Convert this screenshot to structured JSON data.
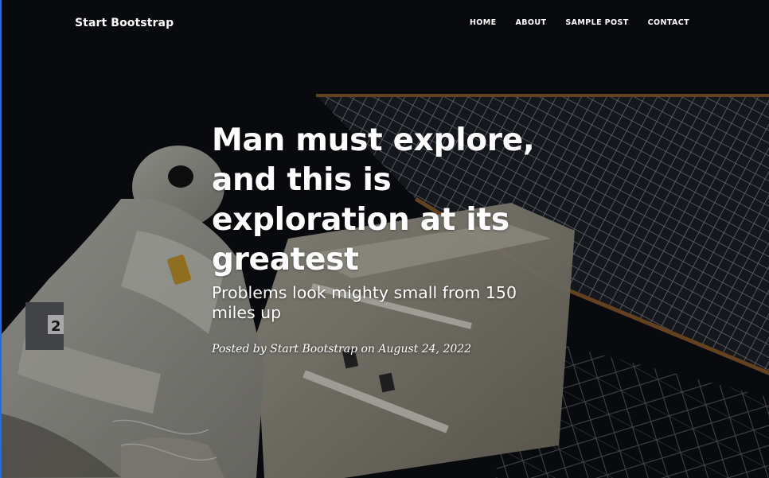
{
  "navbar": {
    "brand": "Start Bootstrap",
    "links": [
      "HOME",
      "ABOUT",
      "SAMPLE POST",
      "CONTACT"
    ]
  },
  "header": {
    "title": "Man must explore, and this is exploration at its greatest",
    "subtitle": "Problems look mighty small from 150 miles up",
    "meta": "Posted by Start Bootstrap on August 24, 2022"
  },
  "colors": {
    "background": "#0d0f13",
    "text": "#ffffff",
    "accent_edge": "#1e6fd9"
  }
}
